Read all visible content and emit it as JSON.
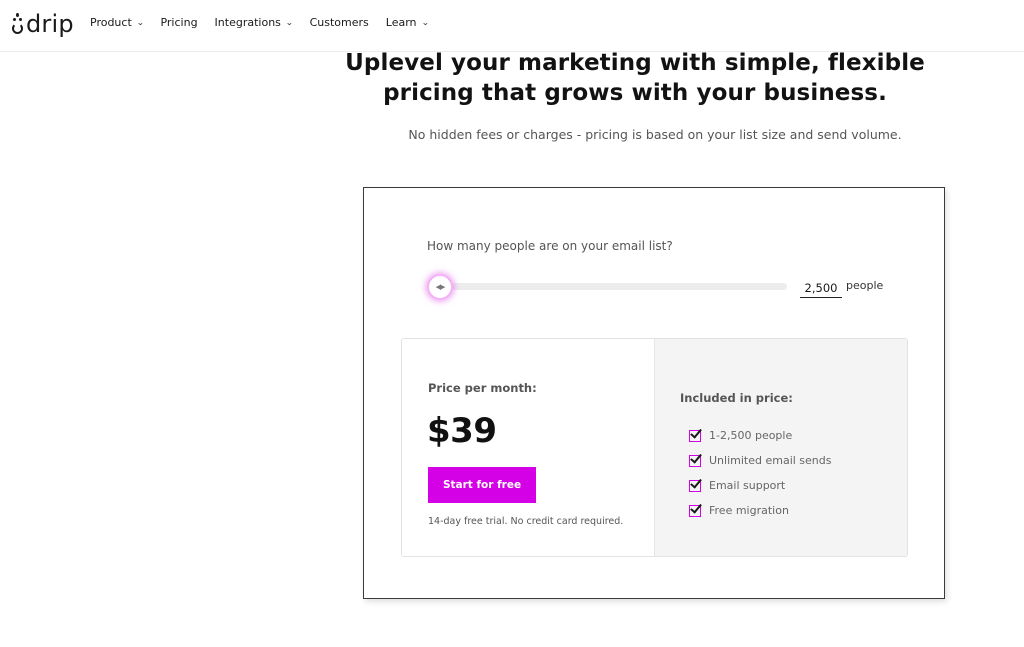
{
  "nav": {
    "logo_text": "drip",
    "items": [
      {
        "label": "Product",
        "has_dropdown": true
      },
      {
        "label": "Pricing",
        "has_dropdown": false
      },
      {
        "label": "Integrations",
        "has_dropdown": true
      },
      {
        "label": "Customers",
        "has_dropdown": false
      },
      {
        "label": "Learn",
        "has_dropdown": true
      }
    ],
    "chevron_glyph": "⌄"
  },
  "hero": {
    "title_line1": "Uplevel your marketing with simple, flexible",
    "title_line2": "pricing that grows with your business.",
    "subtitle": "No hidden fees or charges - pricing is based on your list size and send volume."
  },
  "calculator": {
    "question": "How many people are on your email list?",
    "slider_position_fraction": 0,
    "slider_thumb_glyph": "◀▶",
    "list_size_value": "2,500",
    "list_size_unit": "people"
  },
  "price": {
    "label": "Price per month:",
    "value": "$39",
    "cta_label": "Start for free",
    "trial_note": "14-day free trial. No credit card required."
  },
  "included": {
    "title": "Included in price:",
    "items": [
      "1-2,500 people",
      "Unlimited email sends",
      "Email support",
      "Free migration"
    ]
  },
  "colors": {
    "accent": "#d400e6",
    "text_primary": "#121212",
    "text_muted": "#555555",
    "panel_bg": "#f4f4f4"
  }
}
